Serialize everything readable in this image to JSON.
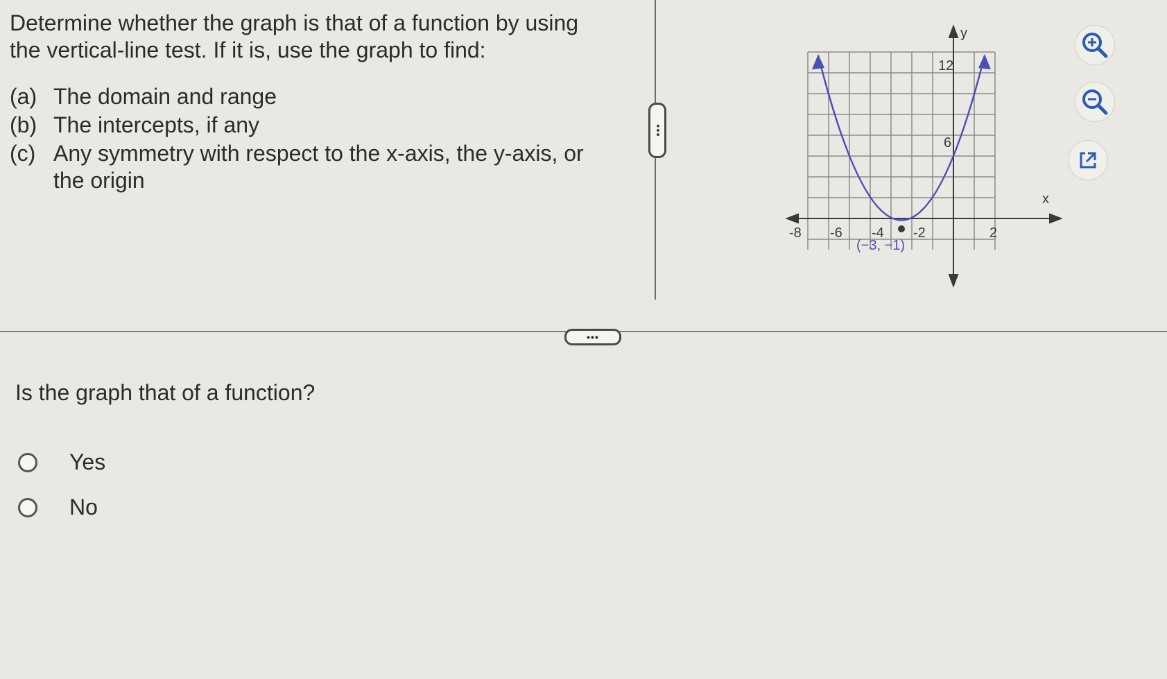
{
  "question": {
    "line1": "Determine whether the graph is that of a function by using",
    "line2": "the vertical-line test. If it is, use the graph to find:",
    "parts": [
      {
        "label": "(a)",
        "text": "The domain and range"
      },
      {
        "label": "(b)",
        "text": "The intercepts, if any"
      },
      {
        "label": "(c)",
        "text": "Any symmetry with respect to the x-axis, the y-axis, or the origin"
      }
    ]
  },
  "graph": {
    "y_axis_label": "y",
    "x_axis_label": "x",
    "x_tick_labels": [
      "-8",
      "-6",
      "-4",
      "-2",
      "2"
    ],
    "y_tick_labels": [
      "12",
      "6"
    ],
    "vertex_label": "(−3, −1)",
    "curve_color": "#4a4fb5"
  },
  "divider_handle_glyph": "•••",
  "prompt": "Is the graph that of a function?",
  "options": [
    {
      "label": "Yes"
    },
    {
      "label": "No"
    }
  ],
  "tools": [
    "zoom-in-icon",
    "zoom-out-icon",
    "popout-icon"
  ]
}
